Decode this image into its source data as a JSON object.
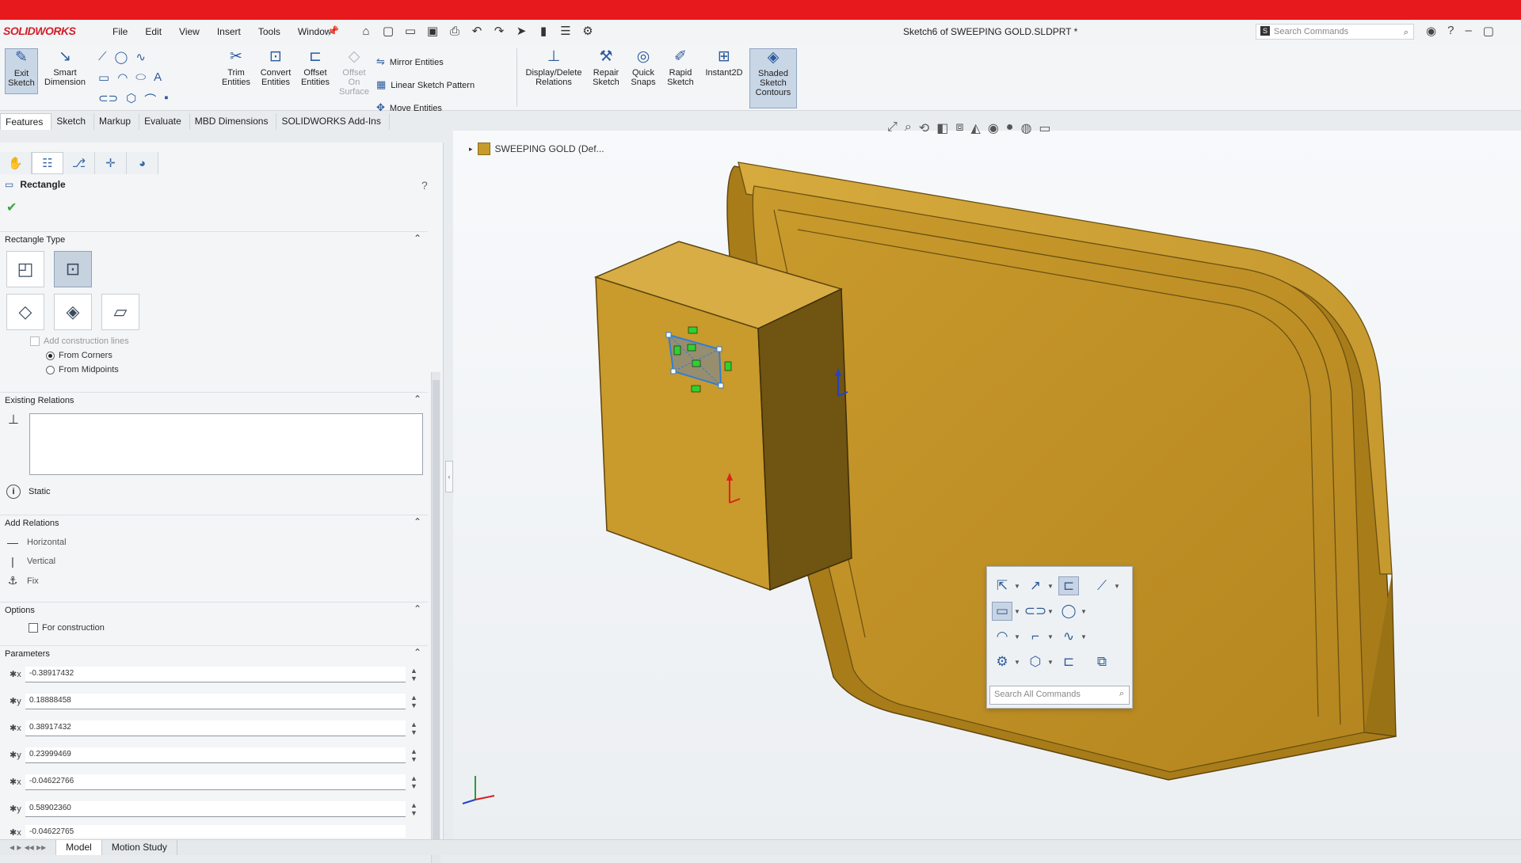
{
  "app": {
    "logo": "SOLIDWORKS"
  },
  "menu": [
    "File",
    "Edit",
    "View",
    "Insert",
    "Tools",
    "Window"
  ],
  "document_title": "Sketch6 of SWEEPING GOLD.SLDPRT *",
  "search": {
    "placeholder": "Search Commands"
  },
  "ribbon": {
    "exit_sketch": "Exit Sketch",
    "smart_dimension": "Smart Dimension",
    "trim_entities": "Trim Entities",
    "convert_entities": "Convert Entities",
    "offset_entities": "Offset Entities",
    "offset_on_surface": "Offset On Surface",
    "mirror_entities": "Mirror Entities",
    "linear_sketch_pattern": "Linear Sketch Pattern",
    "move_entities": "Move Entities",
    "display_delete_relations": "Display/Delete Relations",
    "repair_sketch": "Repair Sketch",
    "quick_snaps": "Quick Snaps",
    "rapid_sketch": "Rapid Sketch",
    "instant2d": "Instant2D",
    "shaded_sketch_contours": "Shaded Sketch Contours"
  },
  "cm_tabs": [
    "Features",
    "Sketch",
    "Markup",
    "Evaluate",
    "MBD Dimensions",
    "SOLIDWORKS Add-Ins"
  ],
  "property_manager": {
    "title": "Rectangle",
    "rectangle_type": {
      "title": "Rectangle Type",
      "add_construction_lines": "Add construction lines",
      "from_corners": "From Corners",
      "from_midpoints": "From Midpoints"
    },
    "existing_relations": {
      "title": "Existing Relations",
      "status": "Static"
    },
    "add_relations": {
      "title": "Add Relations",
      "items": [
        "Horizontal",
        "Vertical",
        "Fix"
      ]
    },
    "options": {
      "title": "Options",
      "for_construction": "For construction"
    },
    "parameters": {
      "title": "Parameters",
      "values": [
        "-0.38917432",
        "0.18888458",
        "0.38917432",
        "0.23999469",
        "-0.04622766",
        "0.58902360",
        "-0.04622765"
      ]
    }
  },
  "viewport": {
    "tree_root": "SWEEPING GOLD (Def..."
  },
  "shortcut_bar": {
    "search_placeholder": "Search All Commands"
  },
  "bottom_tabs": [
    "Model",
    "Motion Study"
  ],
  "colors": {
    "accent_red": "#e8191d",
    "part_gold": "#c79b2a",
    "sketch_blue": "#2f7fd6",
    "relation_green": "#2fd12f"
  }
}
